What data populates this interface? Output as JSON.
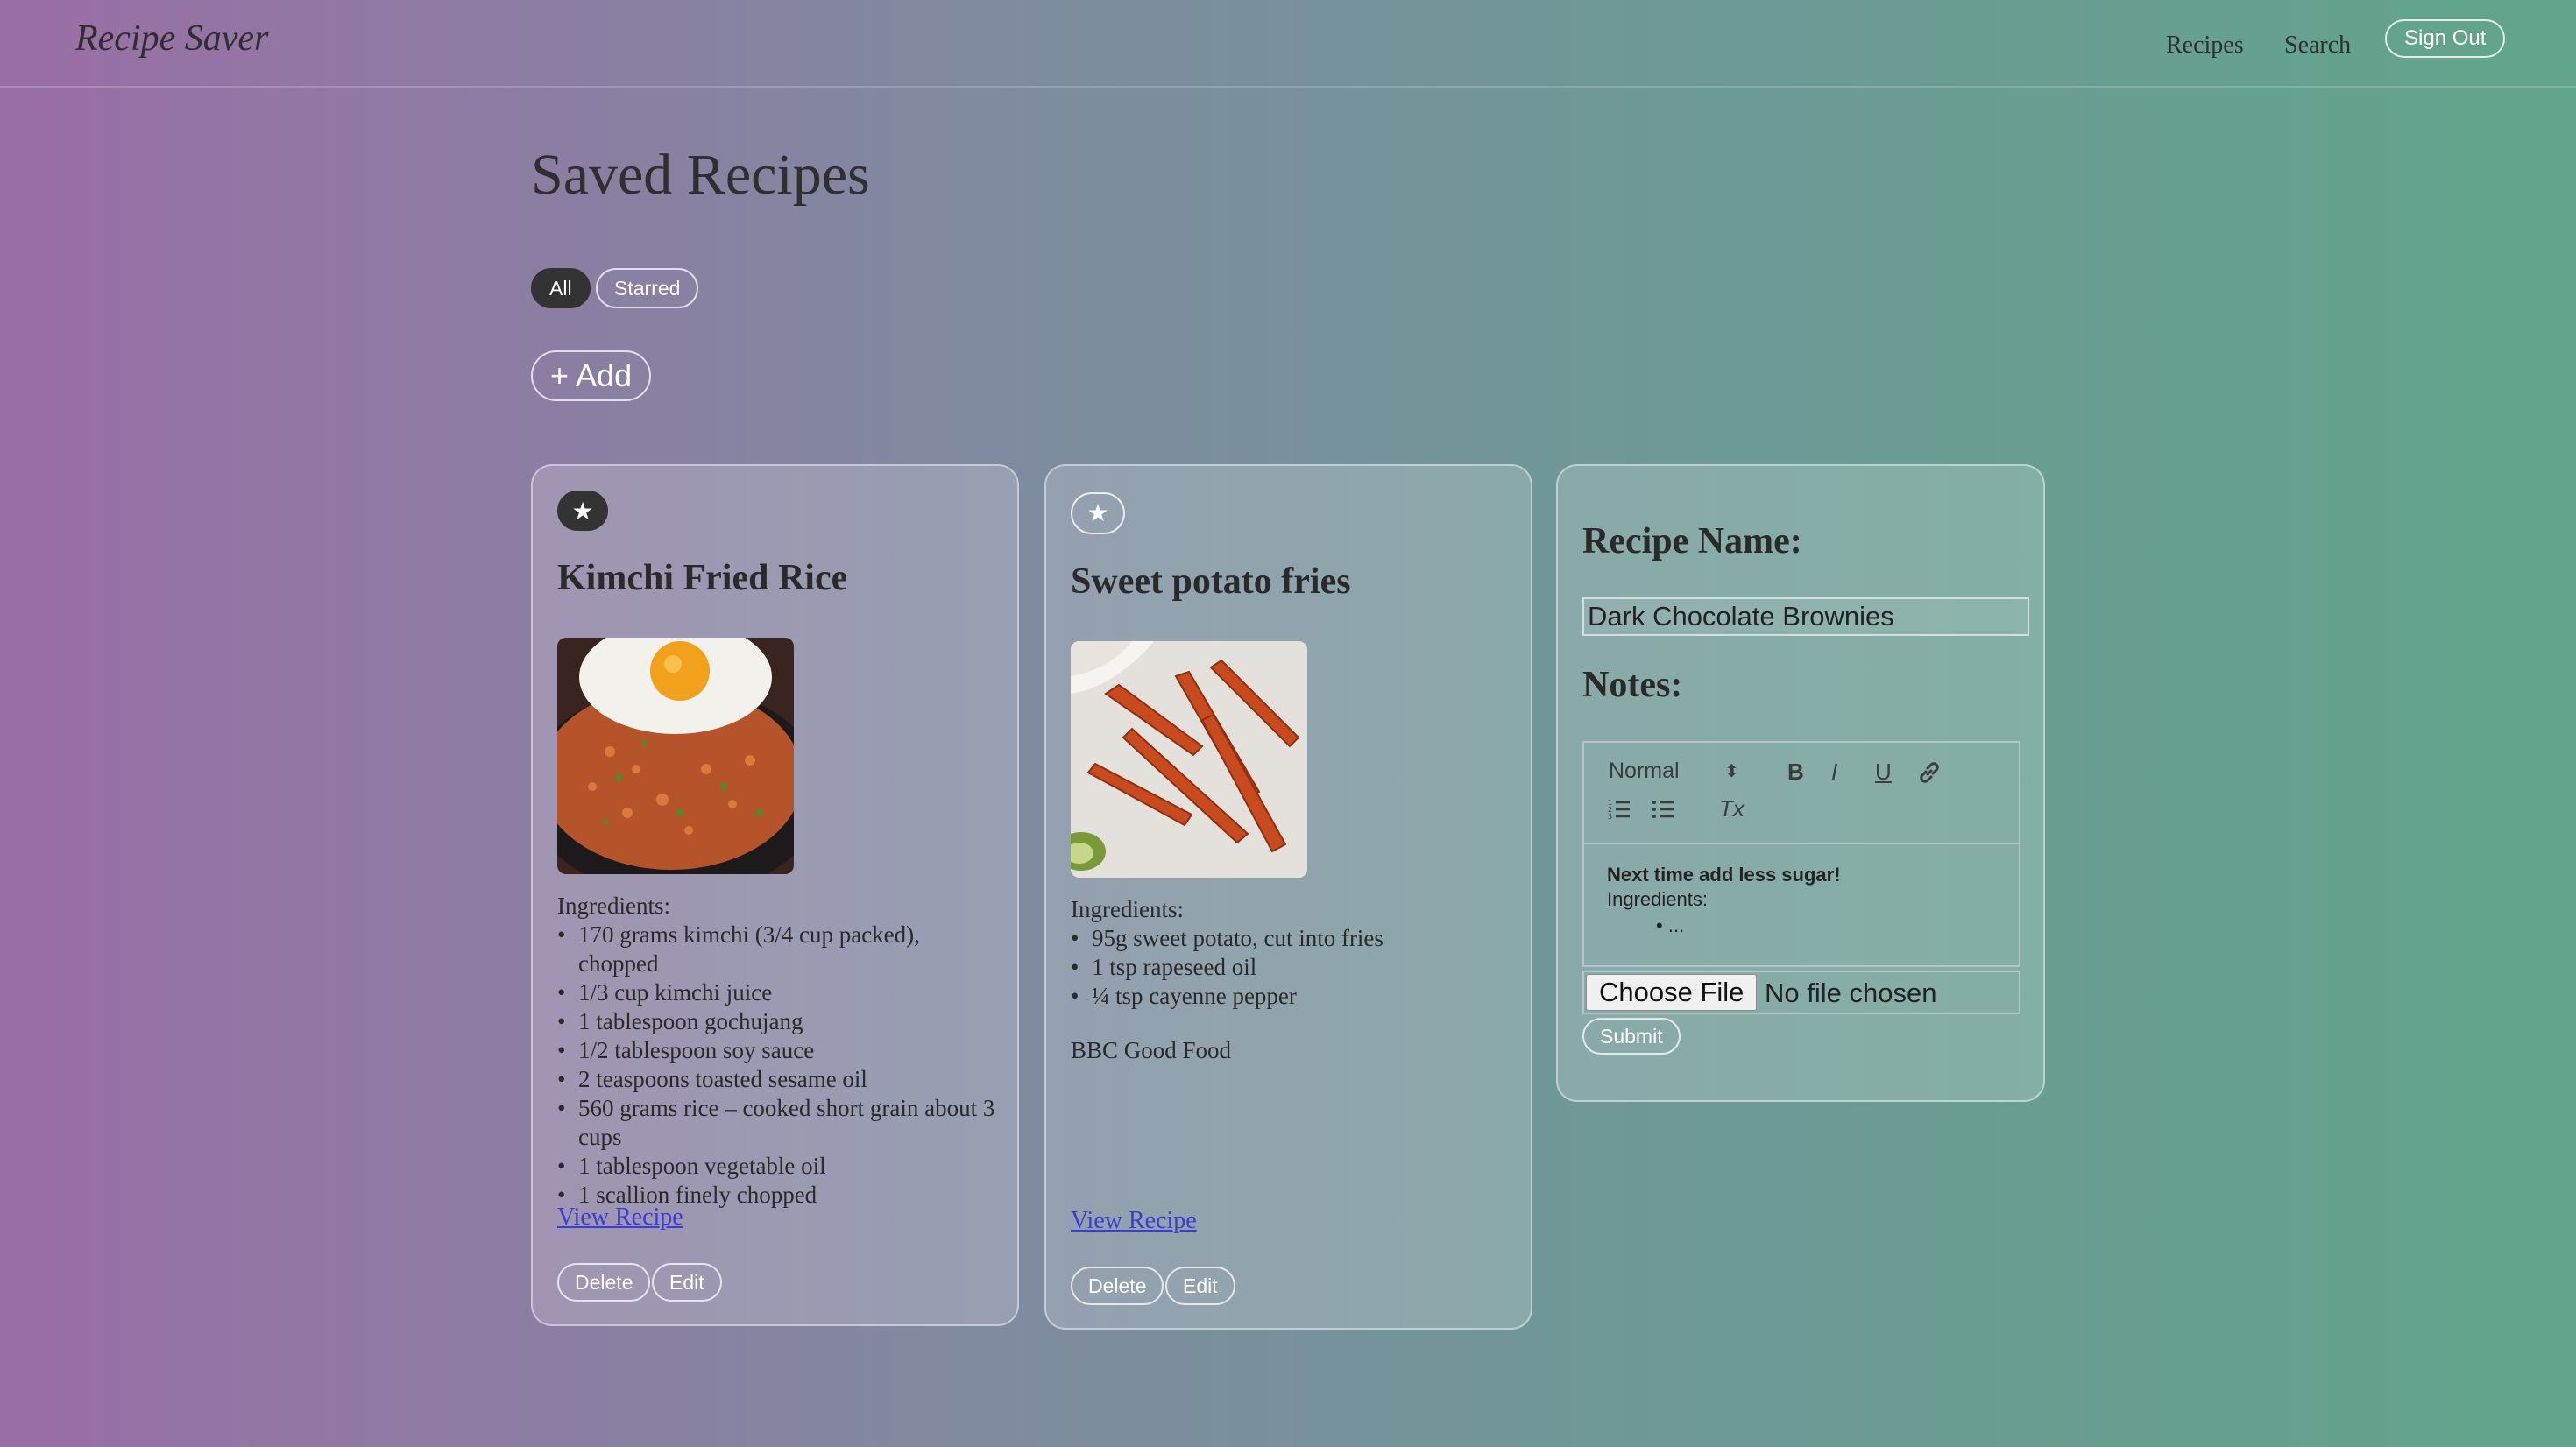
{
  "nav": {
    "brand": "Recipe Saver",
    "links": [
      "Recipes",
      "Search"
    ],
    "sign_out": "Sign Out"
  },
  "page": {
    "title": "Saved Recipes",
    "filters": [
      "All",
      "Starred"
    ],
    "active_filter": "All",
    "add_label": "+ Add"
  },
  "recipes": [
    {
      "starred": true,
      "star_icon": "★",
      "title": "Kimchi Fried Rice",
      "image": "kimchi-fried-rice-photo",
      "ingredients_heading": "Ingredients:",
      "ingredients": [
        "170 grams kimchi (3/4 cup packed), chopped",
        "1/3 cup kimchi juice",
        "1 tablespoon gochujang",
        "1/2 tablespoon soy sauce",
        "2 teaspoons toasted sesame oil",
        "560 grams rice – cooked short grain about 3 cups",
        "1 tablespoon vegetable oil",
        "1 scallion finely chopped"
      ],
      "source": "",
      "view_label": "View Recipe",
      "delete_label": "Delete",
      "edit_label": "Edit"
    },
    {
      "starred": false,
      "star_icon": "★",
      "title": "Sweet potato fries",
      "image": "sweet-potato-fries-photo",
      "ingredients_heading": "Ingredients:",
      "ingredients": [
        "95g sweet potato, cut into fries",
        "1 tsp rapeseed oil",
        "¼ tsp cayenne pepper"
      ],
      "source": "BBC Good Food",
      "view_label": "View Recipe",
      "delete_label": "Delete",
      "edit_label": "Edit"
    }
  ],
  "form": {
    "name_label": "Recipe Name:",
    "name_value": "Dark Chocolate Brownies",
    "notes_label": "Notes:",
    "toolbar": {
      "format": "Normal",
      "format_arrow": "⬍",
      "bold": "B",
      "italic": "I",
      "underline": "U",
      "link_icon": "link-icon",
      "ordered_list_icon": "ordered-list-icon",
      "bullet_list_icon": "bullet-list-icon",
      "clear_format": "Tx"
    },
    "notes": {
      "line1": "Next time add less sugar!",
      "line2": "Ingredients:",
      "bullet": "..."
    },
    "choose_file": "Choose File",
    "file_status": "No file chosen",
    "submit": "Submit"
  }
}
